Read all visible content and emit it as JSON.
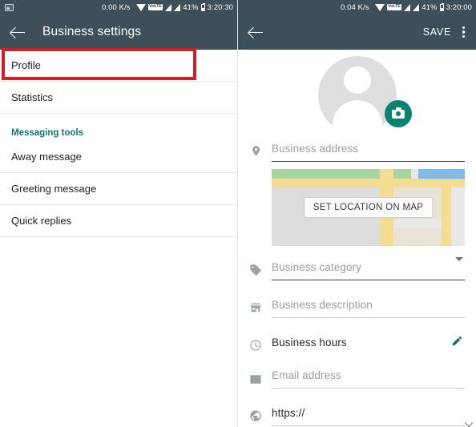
{
  "left": {
    "statusbar": {
      "photo_icon": "photo-icon",
      "data_rate": "0.00 K/s",
      "wifi_icon": "wifi-icon",
      "volte_label": "VoLTE",
      "signal_icon_1": "signal-bars-icon",
      "signal_icon_2": "signal-bars-icon",
      "battery_percent": "41%",
      "battery_icon": "battery-icon",
      "clock": "3:20:30"
    },
    "toolbar": {
      "back_icon": "back-arrow-icon",
      "title": "Business settings"
    },
    "menu": {
      "items": [
        {
          "label": "Profile",
          "type": "item",
          "highlighted": true
        },
        {
          "label": "Statistics",
          "type": "item"
        },
        {
          "label": "Messaging tools",
          "type": "section"
        },
        {
          "label": "Away message",
          "type": "item"
        },
        {
          "label": "Greeting message",
          "type": "item"
        },
        {
          "label": "Quick replies",
          "type": "item"
        }
      ]
    }
  },
  "right": {
    "statusbar": {
      "data_rate": "0.04 K/s",
      "wifi_icon": "wifi-icon",
      "volte_label": "VoLTE",
      "battery_percent": "41%",
      "clock": "3:20:00"
    },
    "toolbar": {
      "back_icon": "back-arrow-icon",
      "save_label": "SAVE",
      "overflow_icon": "overflow-menu-icon"
    },
    "avatar": {
      "placeholder_icon": "person-avatar-icon",
      "camera_button": "camera-icon"
    },
    "fields": [
      {
        "icon": "location-pin-icon",
        "text": "Business address",
        "filled": false,
        "active": true,
        "trailing": "none"
      },
      {
        "icon": "tag-icon",
        "text": "Business category",
        "filled": false,
        "active": true,
        "trailing": "caret"
      },
      {
        "icon": "storefront-icon",
        "text": "Business description",
        "filled": false,
        "active": false,
        "trailing": "none"
      },
      {
        "icon": "clock-icon",
        "text": "Business hours",
        "filled": true,
        "active": false,
        "trailing": "pencil"
      },
      {
        "icon": "envelope-icon",
        "text": "Email address",
        "filled": false,
        "active": false,
        "trailing": "none"
      },
      {
        "icon": "globe-icon",
        "text": "https://",
        "filled": true,
        "active": false,
        "trailing": "clear"
      }
    ],
    "map": {
      "button_label": "SET LOCATION ON MAP"
    }
  },
  "colors": {
    "toolbar": "#3d4f59",
    "accent_teal": "#0a8272",
    "section_teal": "#0c7a6d",
    "highlight_red": "#cf2026",
    "active_underline": "#14594f"
  }
}
